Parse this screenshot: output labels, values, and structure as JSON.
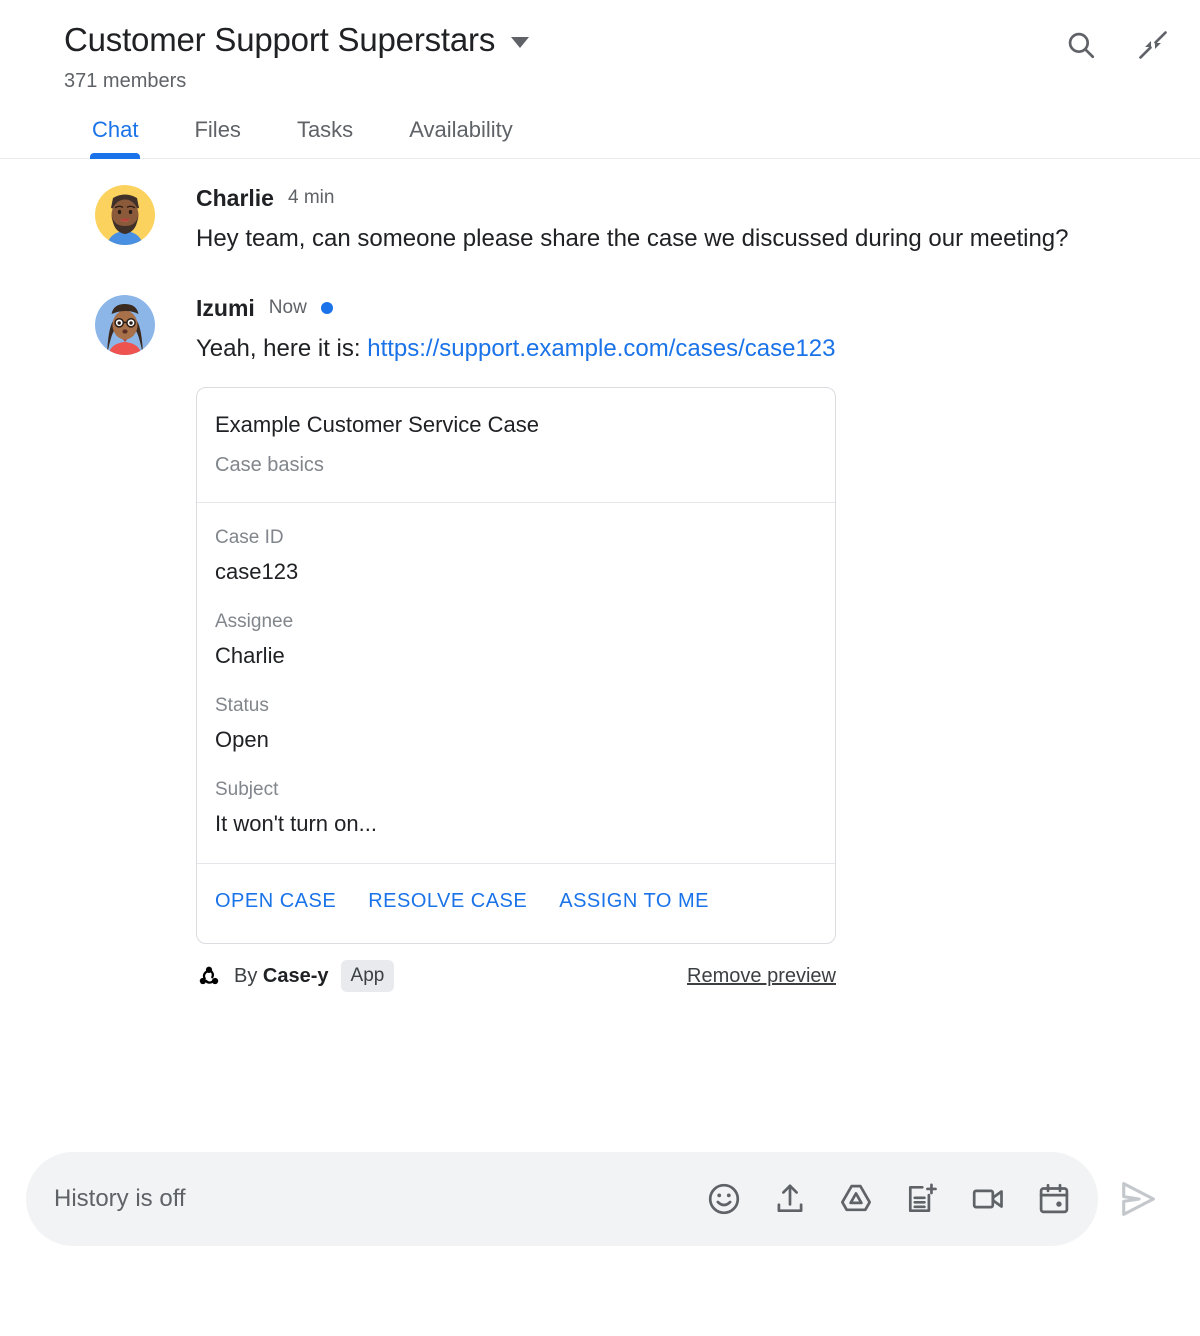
{
  "header": {
    "room_title": "Customer Support Superstars",
    "member_count": "371 members",
    "dropdown_icon": "chevron-down-icon",
    "actions": [
      {
        "name": "search-icon",
        "label": "Search"
      },
      {
        "name": "collapse-icon",
        "label": "Collapse"
      }
    ]
  },
  "tabs": [
    {
      "label": "Chat",
      "active": true
    },
    {
      "label": "Files",
      "active": false
    },
    {
      "label": "Tasks",
      "active": false
    },
    {
      "label": "Availability",
      "active": false
    }
  ],
  "messages": [
    {
      "author": "Charlie",
      "time": "4 min",
      "unread": false,
      "text": "Hey team, can someone please share the case we discussed during our meeting?"
    },
    {
      "author": "Izumi",
      "time": "Now",
      "unread": true,
      "text_prefix": "Yeah, here it is: ",
      "link_text": "https://support.example.com/cases/case123"
    }
  ],
  "card": {
    "title": "Example Customer Service Case",
    "subtitle": "Case basics",
    "fields": [
      {
        "label": "Case ID",
        "value": "case123"
      },
      {
        "label": "Assignee",
        "value": "Charlie"
      },
      {
        "label": "Status",
        "value": "Open"
      },
      {
        "label": "Subject",
        "value": "It won't turn on..."
      }
    ],
    "actions": [
      {
        "label": "OPEN CASE",
        "name": "open-case-button"
      },
      {
        "label": "RESOLVE CASE",
        "name": "resolve-case-button"
      },
      {
        "label": "ASSIGN TO ME",
        "name": "assign-to-me-button"
      }
    ]
  },
  "attribution": {
    "icon": "webhook-icon",
    "by_text": "By ",
    "app_name": "Case-y",
    "app_chip": "App",
    "remove_preview": "Remove preview"
  },
  "compose": {
    "placeholder": "History is off",
    "icons": [
      {
        "name": "emoji-icon",
        "label": "Insert emoji"
      },
      {
        "name": "upload-icon",
        "label": "Upload file"
      },
      {
        "name": "drive-icon",
        "label": "Add from Drive"
      },
      {
        "name": "new-doc-icon",
        "label": "Create new document"
      },
      {
        "name": "video-camera-icon",
        "label": "Start video meeting"
      },
      {
        "name": "calendar-icon",
        "label": "Schedule event"
      }
    ],
    "send_icon": "send-icon"
  },
  "colors": {
    "accent_blue": "#1a73e8",
    "text_primary": "#202124",
    "text_secondary": "#5f6368",
    "text_muted": "#80868b",
    "border": "#dadce0",
    "compose_bg": "#f1f3f4",
    "chip_bg": "#e8eaed",
    "send_disabled": "#c4c8cc"
  }
}
